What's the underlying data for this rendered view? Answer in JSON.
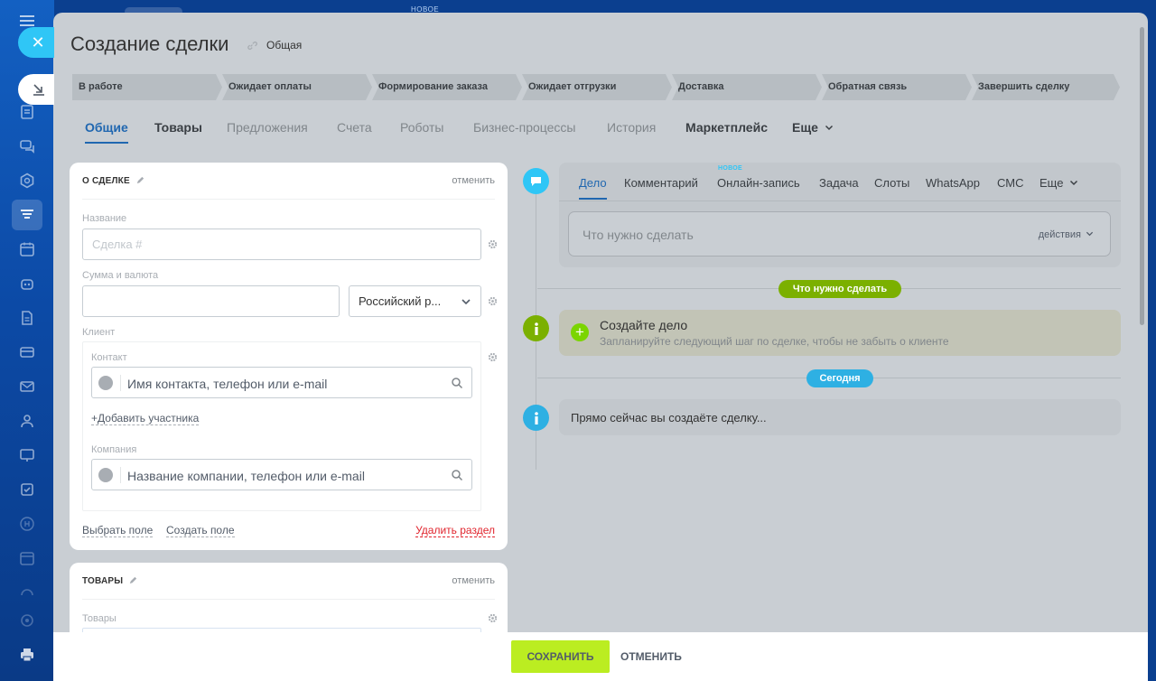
{
  "topbar": {
    "new_badge": "НОВОЕ"
  },
  "header": {
    "title": "Создание сделки",
    "category": "Общая"
  },
  "stages": [
    "В работе",
    "Ожидает оплаты",
    "Формирование заказа",
    "Ожидает отгрузки",
    "Доставка",
    "Обратная связь",
    "Завершить сделку"
  ],
  "tabs": [
    "Общие",
    "Товары",
    "Предложения",
    "Счета",
    "Роботы",
    "Бизнес-процессы",
    "История",
    "Маркетплейс",
    "Еще"
  ],
  "about": {
    "title": "О СДЕЛКЕ",
    "cancel": "отменить",
    "name_label": "Название",
    "name_placeholder": "Сделка #",
    "sum_label": "Сумма и валюта",
    "currency": "Российский р...",
    "client_label": "Клиент",
    "contact_label": "Контакт",
    "contact_placeholder": "Имя контакта, телефон или e-mail",
    "add_participant": "Добавить участника",
    "company_label": "Компания",
    "company_placeholder": "Название компании, телефон или e-mail",
    "choose_field": "Выбрать поле",
    "create_field": "Создать поле",
    "delete_section": "Удалить раздел"
  },
  "products": {
    "title": "ТОВАРЫ",
    "cancel": "отменить",
    "label": "Товары"
  },
  "editor": {
    "tabs": [
      "Дело",
      "Комментарий",
      "Онлайн-запись",
      "Задача",
      "Слоты",
      "WhatsApp",
      "СМС",
      "Еще"
    ],
    "new_badge": "НОВОЕ",
    "placeholder": "Что нужно сделать",
    "actions": "действия"
  },
  "timeline": {
    "todo_pill": "Что нужно сделать",
    "todo_title": "Создайте дело",
    "todo_sub": "Запланируйте следующий шаг по сделке, чтобы не забыть о клиенте",
    "today_pill": "Сегодня",
    "now_text": "Прямо сейчас вы создаёте сделку..."
  },
  "footer": {
    "save": "СОХРАНИТЬ",
    "cancel": "ОТМЕНИТЬ"
  },
  "colors": {
    "accent": "#2067b0",
    "save": "#bbed21",
    "green": "#7bd500",
    "cyan": "#2fc6f6",
    "danger": "#e0252e"
  }
}
